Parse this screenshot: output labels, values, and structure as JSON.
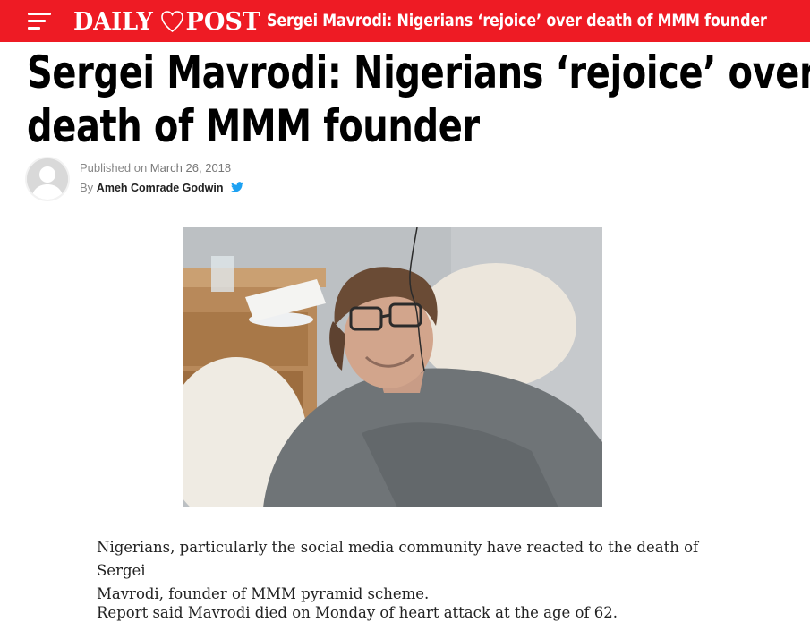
{
  "header": {
    "logo_text_left": "DAILY",
    "logo_text_right": "POST",
    "title": "Sergei Mavrodi: Nigerians ‘rejoice’ over death of MMM founder",
    "bar_color": "#ee1b24"
  },
  "article": {
    "headline_line1": "Sergei Mavrodi: Nigerians ‘rejoice’ over",
    "headline_line2": "death of MMM founder",
    "published_label": "Published on",
    "published_date": "March 26, 2018",
    "by_label": "By",
    "author": "Ameh Comrade Godwin",
    "paragraph1_line1": "Nigerians, particularly the social media community have reacted to the death of Sergei",
    "paragraph1_line2": "Mavrodi, founder of MMM pyramid scheme.",
    "paragraph2": "Report said Mavrodi died on Monday of heart attack at the age of 62."
  },
  "icons": {
    "menu": "hamburger-menu-icon",
    "logo_mark": "heart-map-icon",
    "twitter": "twitter-icon",
    "avatar": "user-avatar-icon"
  },
  "colors": {
    "accent": "#ee1b24",
    "twitter": "#1da1f2"
  }
}
